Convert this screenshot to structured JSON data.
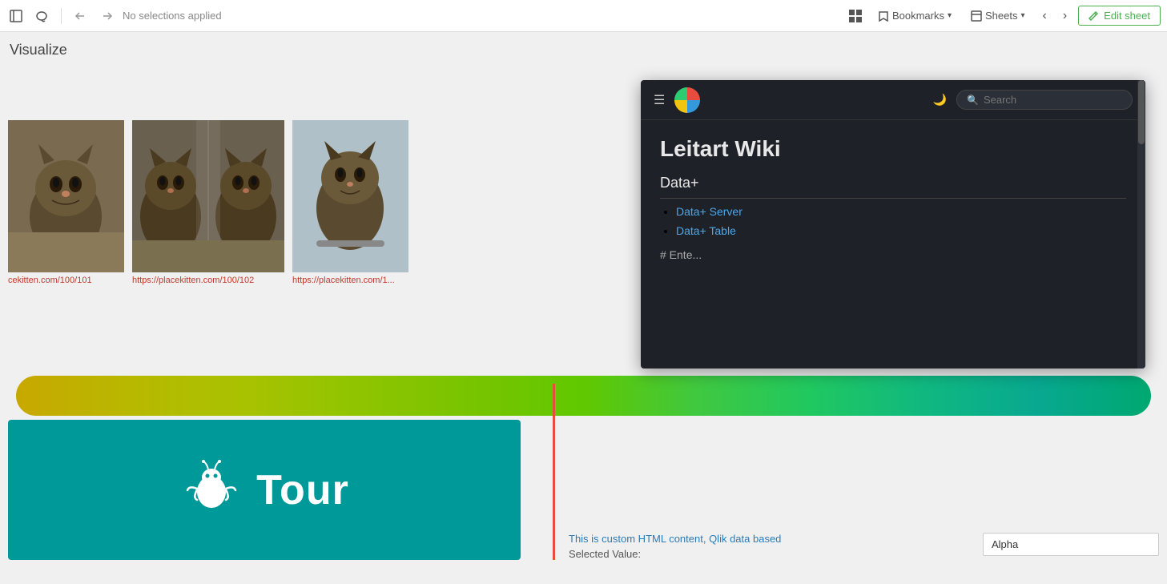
{
  "toolbar": {
    "no_selections": "No selections applied",
    "bookmarks_label": "Bookmarks",
    "sheets_label": "Sheets",
    "edit_sheet_label": "Edit sheet"
  },
  "main": {
    "visualize_label": "Visualize"
  },
  "kittens": [
    {
      "url": "cekitten.com/100/101",
      "color1": "#5a4a3a",
      "color2": "#3a2a1a"
    },
    {
      "url": "https://placekitten.com/100/102",
      "color1": "#4a3a2a",
      "color2": "#6a5a3a"
    },
    {
      "url": "https://placekitten.com/1...",
      "color1": "#4a3a2a",
      "color2": "#2a1a0a"
    }
  ],
  "custom_html": {
    "title": "This is custom HTML content, Qlik data based",
    "sub_label": "Selected Value:",
    "alpha_value": "Alpha"
  },
  "wiki": {
    "title": "Leitart Wiki",
    "section": "Data+",
    "search_placeholder": "Search",
    "items": [
      {
        "label": "Data+ Server"
      },
      {
        "label": "Data+ Table"
      }
    ],
    "faded_text": "# Ente..."
  },
  "tour": {
    "icon": "☁",
    "text": "Tour"
  }
}
